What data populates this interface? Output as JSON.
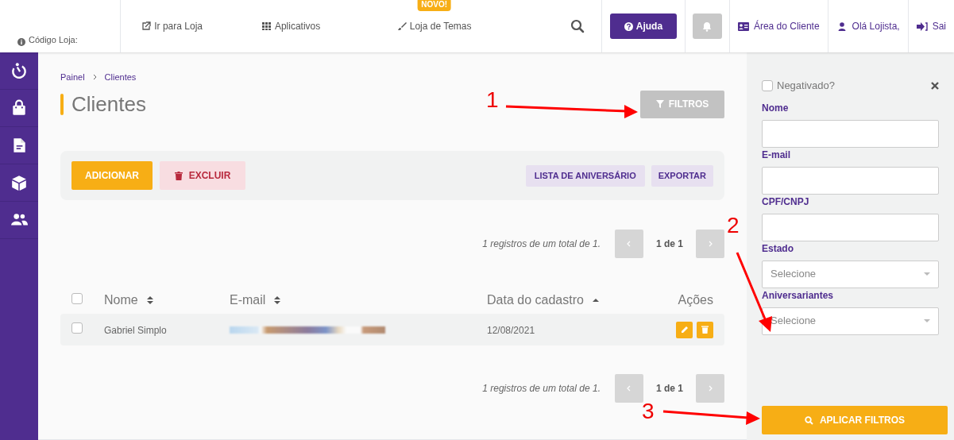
{
  "header": {
    "store_code_label": "Código Loja:",
    "nav": [
      {
        "label": "Ir para Loja",
        "kind": "external"
      },
      {
        "label": "Aplicativos",
        "kind": "grid"
      },
      {
        "label": "Loja de Temas",
        "kind": "brush",
        "badge": "NOVO!"
      }
    ],
    "help_button": "Ajuda",
    "client_area": "Área do Cliente",
    "greeting": "Olá Lojista,",
    "logout": "Sai"
  },
  "breadcrumb": [
    "Painel",
    "Clientes"
  ],
  "title": "Clientes",
  "filters_button": "FILTROS",
  "toolbar": {
    "add": "ADICIONAR",
    "delete": "EXCLUIR",
    "birthday_list": "LISTA DE ANIVERSÁRIO",
    "export": "EXPORTAR"
  },
  "pagination_top": {
    "summary": "1 registros de um total de 1.",
    "page": "1 de 1"
  },
  "table": {
    "all_checked": false,
    "columns": [
      {
        "label": "Nome",
        "kind": "sortable"
      },
      {
        "label": "E-mail",
        "kind": "sortable"
      },
      {
        "label": "Data do cadastro",
        "kind": "ascending"
      },
      {
        "label": "Ações",
        "kind": "plain"
      }
    ],
    "rows": [
      {
        "name": "Gabriel Simplo",
        "date": "12/08/2021",
        "checked": false
      }
    ]
  },
  "pagination_bottom": {
    "summary": "1 registros de um total de 1.",
    "page": "1 de 1"
  },
  "filter_panel": {
    "negativado": {
      "label": "Negativado?",
      "checked": false
    },
    "fields": [
      {
        "label": "Nome",
        "kind": "text"
      },
      {
        "label": "E-mail",
        "kind": "text"
      },
      {
        "label": "CPF/CNPJ",
        "kind": "text"
      },
      {
        "label": "Estado",
        "kind": "select",
        "placeholder": "Selecione"
      },
      {
        "label": "Aniversariantes",
        "kind": "select",
        "placeholder": "Selecione"
      }
    ],
    "apply_button": "APLICAR FILTROS"
  },
  "annotations": [
    {
      "number": "1"
    },
    {
      "number": "2"
    },
    {
      "number": "3"
    }
  ]
}
